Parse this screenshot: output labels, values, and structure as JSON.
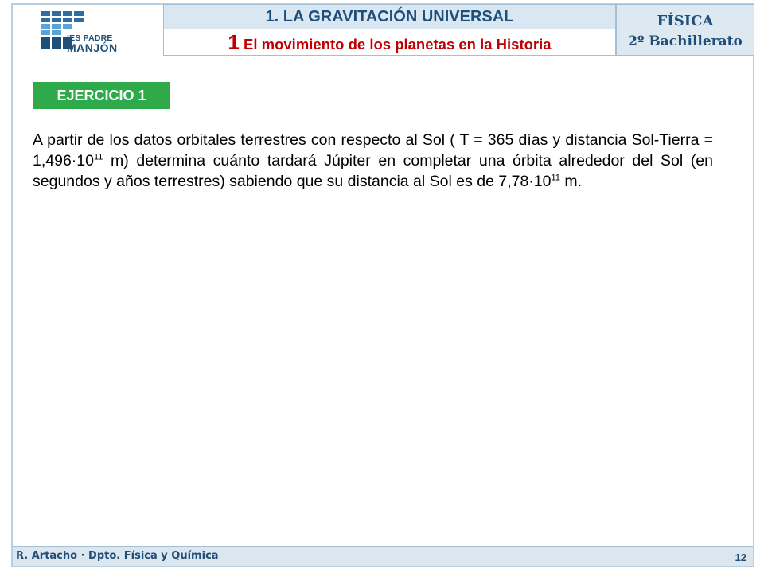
{
  "header": {
    "logo": {
      "line1": "IES PADRE",
      "line2": "MANJÓN"
    },
    "unit_title": "1. LA GRAVITACIÓN UNIVERSAL",
    "section_number": "1",
    "section_title": " El movimiento de los planetas en la Historia",
    "subject_line1": "FÍSICA",
    "subject_line2": "2º Bachillerato"
  },
  "exercise": {
    "label": "EJERCICIO 1"
  },
  "content": {
    "p1": "A partir de los datos orbitales terrestres con respecto al Sol ( T = 365 días y distancia Sol-Tierra = 1,496·10",
    "exp1": "11",
    "p2": " m) determina cuánto tardará Júpiter en completar una órbita alrededor del Sol (en segundos y años terrestres) sabiendo que su distancia al Sol  es de 7,78·10",
    "exp2": "11",
    "p3": " m."
  },
  "footer": {
    "author": "R. Artacho · Dpto. Física y Química",
    "page_number": "12"
  },
  "colors": {
    "accent_green": "#2eaa4a",
    "title_red": "#c00000",
    "navy": "#1f4e79",
    "light_blue": "#d9e7f2"
  }
}
